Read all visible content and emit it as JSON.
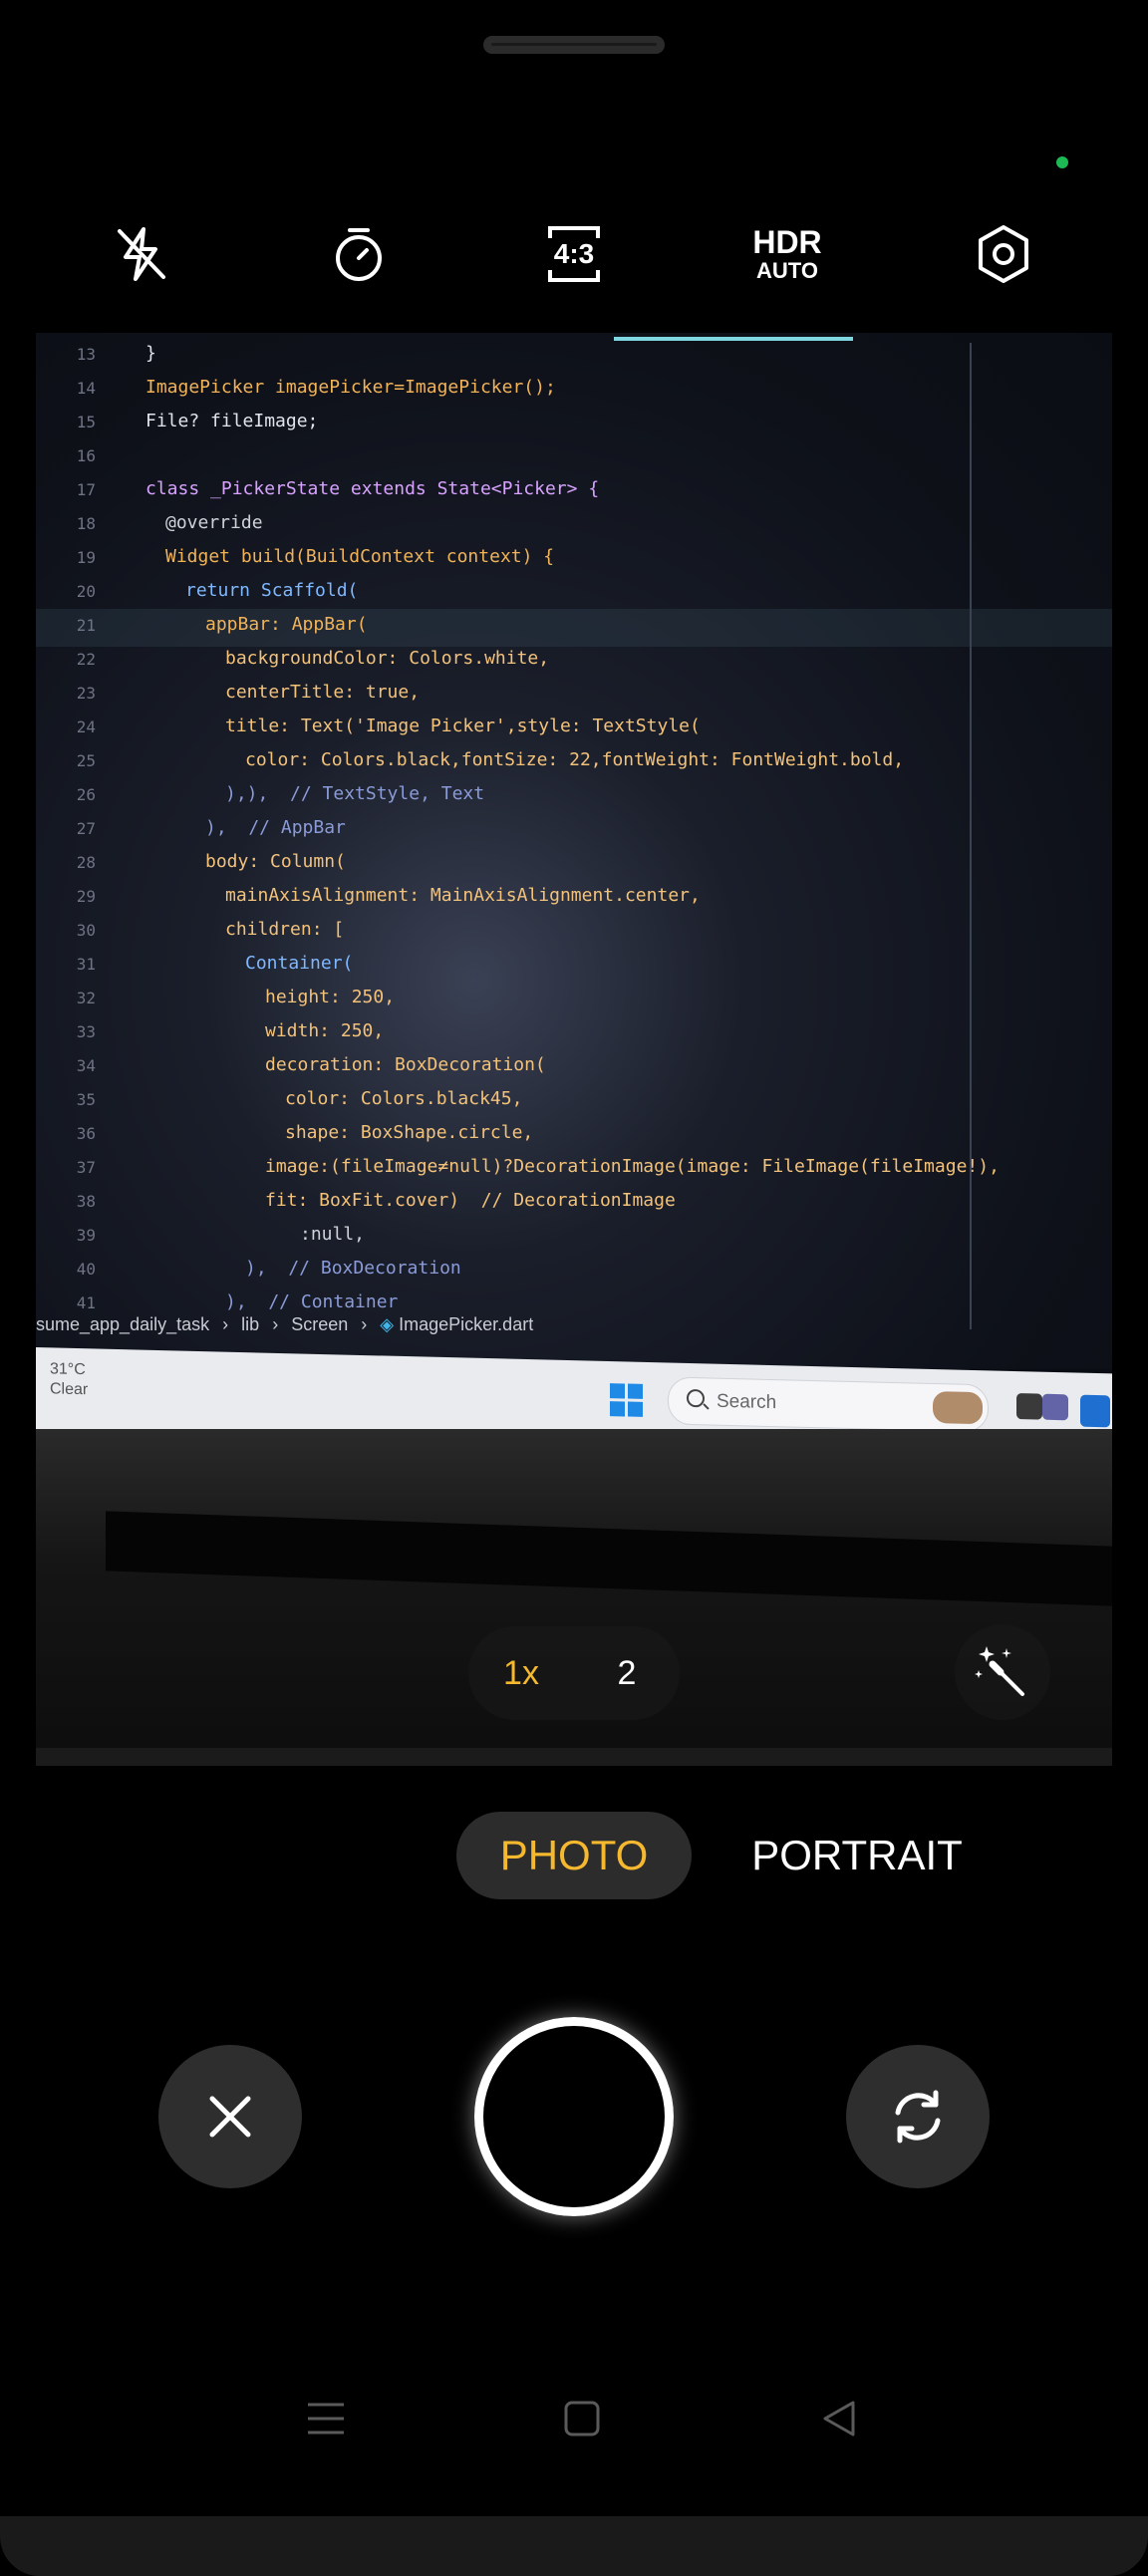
{
  "colors": {
    "background": "#000000",
    "accent": "#F5B82E",
    "icon": "#FFFFFF",
    "privacy_dot": "#1DB954"
  },
  "top_controls": {
    "flash_icon": "flash-off-icon",
    "timer_icon": "timer-icon",
    "aspect_ratio_label": "4:3",
    "hdr_label": "HDR",
    "hdr_mode": "AUTO",
    "settings_icon": "settings-hexagon-icon"
  },
  "viewfinder": {
    "code_lines": [
      {
        "n": "13",
        "t": "}"
      },
      {
        "n": "14",
        "t": "ImagePicker imagePicker=ImagePicker();"
      },
      {
        "n": "15",
        "t": "File? fileImage;"
      },
      {
        "n": "16",
        "t": ""
      },
      {
        "n": "17",
        "t": "class _PickerState extends State<Picker> {"
      },
      {
        "n": "18",
        "t": "@override"
      },
      {
        "n": "19",
        "t": "Widget build(BuildContext context) {"
      },
      {
        "n": "20",
        "t": "return Scaffold("
      },
      {
        "n": "21",
        "t": "appBar: AppBar("
      },
      {
        "n": "22",
        "t": "backgroundColor: Colors.white,"
      },
      {
        "n": "23",
        "t": "centerTitle: true,"
      },
      {
        "n": "24",
        "t": "title: Text('Image Picker',style: TextStyle("
      },
      {
        "n": "25",
        "t": "color: Colors.black,fontSize: 22,fontWeight: FontWeight.bold,"
      },
      {
        "n": "26",
        "t": "),),  // TextStyle, Text"
      },
      {
        "n": "27",
        "t": "),  // AppBar"
      },
      {
        "n": "28",
        "t": "body: Column("
      },
      {
        "n": "29",
        "t": "mainAxisAlignment: MainAxisAlignment.center,"
      },
      {
        "n": "30",
        "t": "children: ["
      },
      {
        "n": "31",
        "t": "Container("
      },
      {
        "n": "32",
        "t": "height: 250,"
      },
      {
        "n": "33",
        "t": "width: 250,"
      },
      {
        "n": "34",
        "t": "decoration: BoxDecoration("
      },
      {
        "n": "35",
        "t": "color: Colors.black45,"
      },
      {
        "n": "36",
        "t": "shape: BoxShape.circle,"
      },
      {
        "n": "37",
        "t": "image:(fileImage≠null)?DecorationImage(image: FileImage(fileImage!),"
      },
      {
        "n": "38",
        "t": "fit: BoxFit.cover)  // DecorationImage"
      },
      {
        "n": "39",
        "t": ":null,"
      },
      {
        "n": "40",
        "t": "),  // BoxDecoration"
      },
      {
        "n": "41",
        "t": "),  // Container"
      }
    ],
    "breadcrumb": {
      "project": "sume_app_daily_task",
      "folder1": "lib",
      "folder2": "Screen",
      "file": "ImagePicker.dart"
    },
    "taskbar": {
      "temperature": "31°C",
      "condition": "Clear",
      "search_label": "Search"
    }
  },
  "zoom": {
    "options": [
      "1x",
      "2"
    ],
    "selected": "1x"
  },
  "magic_icon": "magic-wand-icon",
  "modes": {
    "items": [
      "PHOTO",
      "PORTRAIT"
    ],
    "selected": "PHOTO"
  },
  "bottom_controls": {
    "close_icon": "close-icon",
    "shutter": "shutter-button",
    "switch_camera_icon": "switch-camera-icon"
  },
  "navigation": {
    "menu_icon": "menu-icon",
    "home_icon": "home-icon",
    "back_icon": "back-icon"
  }
}
